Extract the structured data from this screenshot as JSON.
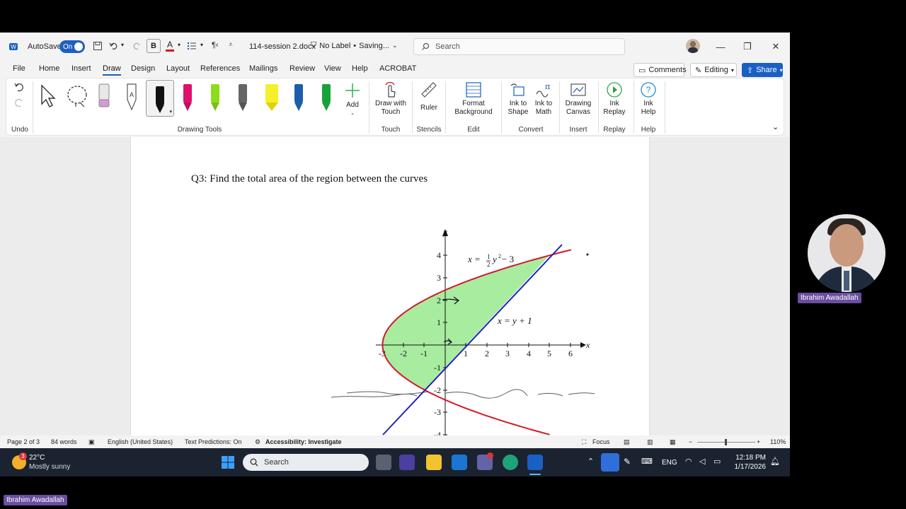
{
  "titlebar": {
    "autosave_label": "AutoSave",
    "autosave_state": "On",
    "file_name": "114-session 2.docx",
    "label_status": "No Label",
    "saving_status": "Saving...",
    "search_placeholder": "Search"
  },
  "menu": {
    "items": [
      "File",
      "Home",
      "Insert",
      "Draw",
      "Design",
      "Layout",
      "References",
      "Mailings",
      "Review",
      "View",
      "Help",
      "ACROBAT"
    ],
    "active": "Draw",
    "comments_label": "Comments",
    "editing_label": "Editing",
    "share_label": "Share"
  },
  "ribbon": {
    "undo_label": "Undo",
    "drawing_tools_label": "Drawing Tools",
    "add_label": "Add",
    "draw_with_touch_label": "Draw with Touch",
    "touch_label": "Touch",
    "ruler_label": "Ruler",
    "stencils_label": "Stencils",
    "format_background_label": "Format Background",
    "edit_label": "Edit",
    "ink_to_shape_label": "Ink to Shape",
    "ink_to_math_label": "Ink to Math",
    "convert_label": "Convert",
    "drawing_canvas_label": "Drawing Canvas",
    "insert_label": "Insert",
    "ink_replay_label": "Ink Replay",
    "replay_label": "Replay",
    "ink_help_label": "Ink Help",
    "help_label": "Help",
    "pen_colors": [
      "#111111",
      "#e0106a",
      "#8fdc1c",
      "#666666",
      "#f5f02a",
      "#1b5fa8",
      "#17a33a"
    ]
  },
  "document": {
    "question": "Q3: Find the total area of the region between the curves",
    "graph": {
      "y_axis_label": "y",
      "x_axis_label": "x",
      "x_ticks": [
        "-3",
        "-2",
        "-1",
        "1",
        "2",
        "3",
        "4",
        "5",
        "6"
      ],
      "y_ticks": [
        "4",
        "3",
        "2",
        "1",
        "-1",
        "-2",
        "-3",
        "-4"
      ],
      "curve1_label_prefix": "x = ",
      "curve1_fraction_num": "1",
      "curve1_fraction_den": "2",
      "curve1_label_suffix": "y",
      "curve1_exponent": "2",
      "curve1_label_tail": " − 3",
      "curve2_label": "x = y + 1",
      "parabola_color": "#d41a2a",
      "line_color": "#2222bb",
      "fill_color": "#a8eca0"
    }
  },
  "statusbar": {
    "page": "Page 2 of 3",
    "words": "84 words",
    "language": "English (United States)",
    "text_predictions": "Text Predictions: On",
    "accessibility": "Accessibility: Investigate",
    "focus": "Focus",
    "zoom": "110%"
  },
  "taskbar": {
    "weather_badge": "3",
    "temperature": "22°C",
    "weather": "Mostly sunny",
    "search_placeholder": "Search",
    "language": "ENG",
    "time": "12:18 PM",
    "date": "1/17/2026"
  },
  "presenter": {
    "name": "Ibrahim Awadallah"
  }
}
